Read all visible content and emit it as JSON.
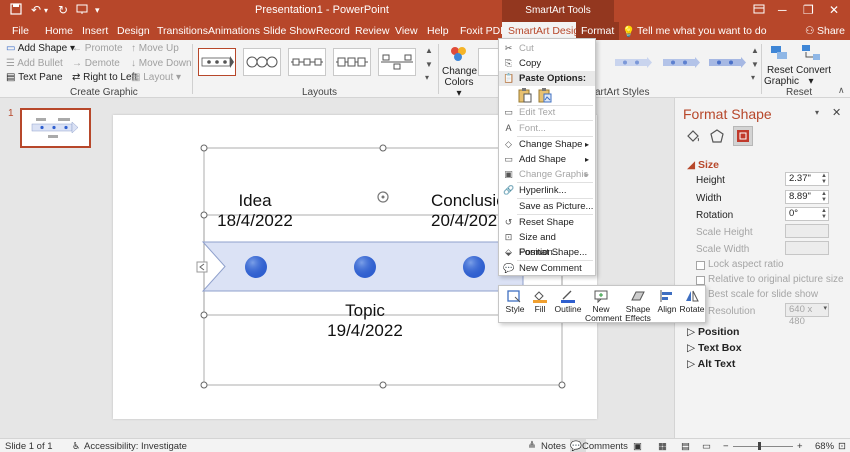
{
  "titlebar": {
    "title": "Presentation1  -  PowerPoint",
    "contextual_group": "SmartArt Tools",
    "quick_access": [
      "save-icon",
      "undo-icon",
      "redo-icon",
      "slideshow-icon",
      "customize-icon"
    ],
    "window_controls": [
      "ribbon-display-icon",
      "minimize-icon",
      "restore-icon",
      "close-icon"
    ]
  },
  "tabs": {
    "file": "File",
    "home": "Home",
    "insert": "Insert",
    "design": "Design",
    "transitions": "Transitions",
    "animations": "Animations",
    "slideshow": "Slide Show",
    "record": "Record",
    "review": "Review",
    "view": "View",
    "help": "Help",
    "foxit": "Foxit PDF",
    "smartart_design": "SmartArt Design",
    "format": "Format",
    "tellme": "Tell me what you want to do",
    "share": "Share"
  },
  "ribbon": {
    "create_graphic": {
      "add_shape": "Add Shape",
      "add_bullet": "Add Bullet",
      "text_pane": "Text Pane",
      "promote": "Promote",
      "demote": "Demote",
      "right_to_left": "Right to Left",
      "move_up": "Move Up",
      "move_down": "Move Down",
      "layout": "Layout",
      "label": "Create Graphic"
    },
    "layouts_label": "Layouts",
    "change_colors": "Change Colors",
    "styles_label": "SmartArt Styles",
    "reset_graphic": "Reset Graphic",
    "convert": "Convert",
    "reset_label": "Reset"
  },
  "slide_panel": {
    "slide_number": "1"
  },
  "slide": {
    "idea_title": "Idea",
    "idea_date": "18/4/2022",
    "conclusion_title": "Conclusion",
    "conclusion_date": "20/4/2022",
    "topic_title": "Topic",
    "topic_date": "19/4/2022",
    "accent_color": "#b7472a",
    "arrow_fill": "#dbe2f5",
    "dot_color": "#2f5fcf"
  },
  "context_menu": {
    "cut": "Cut",
    "copy": "Copy",
    "paste_options": "Paste Options:",
    "edit_text": "Edit Text",
    "font": "Font...",
    "change_shape": "Change Shape",
    "add_shape": "Add Shape",
    "change_graphic": "Change Graphic",
    "hyperlink": "Hyperlink...",
    "save_as_picture": "Save as Picture...",
    "reset_shape": "Reset Shape",
    "size_position": "Size and Position...",
    "format_shape": "Format Shape...",
    "new_comment": "New Comment"
  },
  "mini_toolbar": {
    "style": "Style",
    "fill": "Fill",
    "outline": "Outline",
    "new_comment_1": "New",
    "new_comment_2": "Comment",
    "shape_effects_1": "Shape",
    "shape_effects_2": "Effects",
    "align": "Align",
    "rotate": "Rotate"
  },
  "format_pane": {
    "title": "Format Shape",
    "size_section": "Size",
    "height_label": "Height",
    "height_value": "2.37\"",
    "width_label": "Width",
    "width_value": "8.89\"",
    "rotation_label": "Rotation",
    "rotation_value": "0°",
    "scale_height": "Scale Height",
    "scale_width": "Scale Width",
    "lock_aspect": "Lock aspect ratio",
    "relative_original": "Relative to original picture size",
    "best_scale": "Best scale for slide show",
    "resolution_label": "Resolution",
    "resolution_value": "640 x 480",
    "position_section": "Position",
    "textbox_section": "Text Box",
    "alttext_section": "Alt Text"
  },
  "statusbar": {
    "slide_info": "Slide 1 of 1",
    "accessibility": "Accessibility: Investigate",
    "notes": "Notes",
    "comments": "Comments",
    "zoom": "68%"
  }
}
